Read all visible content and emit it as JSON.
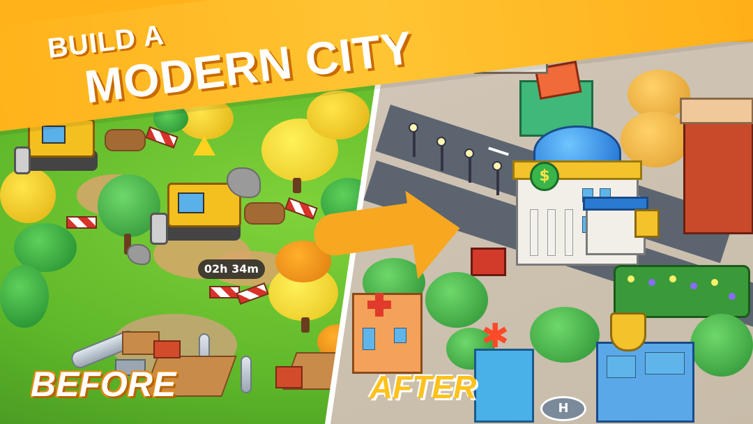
{
  "banner": {
    "line1": "BUILD A",
    "line2": "MODERN CITY",
    "color": "#ffb21a"
  },
  "timer": {
    "text": "02h 34m"
  },
  "labels": {
    "before": "BEFORE",
    "after": "AFTER"
  },
  "icons": {
    "warning_sign": "warning-icon",
    "bank_dollar": "dollar-sign-icon",
    "hospital_cross": "medical-cross-icon",
    "police_badge": "police-badge-icon",
    "helipad": "helipad-icon",
    "arrow": "arrow-right-icon"
  },
  "bank_sign": {
    "text": "$"
  },
  "helipad": {
    "text": "H"
  }
}
